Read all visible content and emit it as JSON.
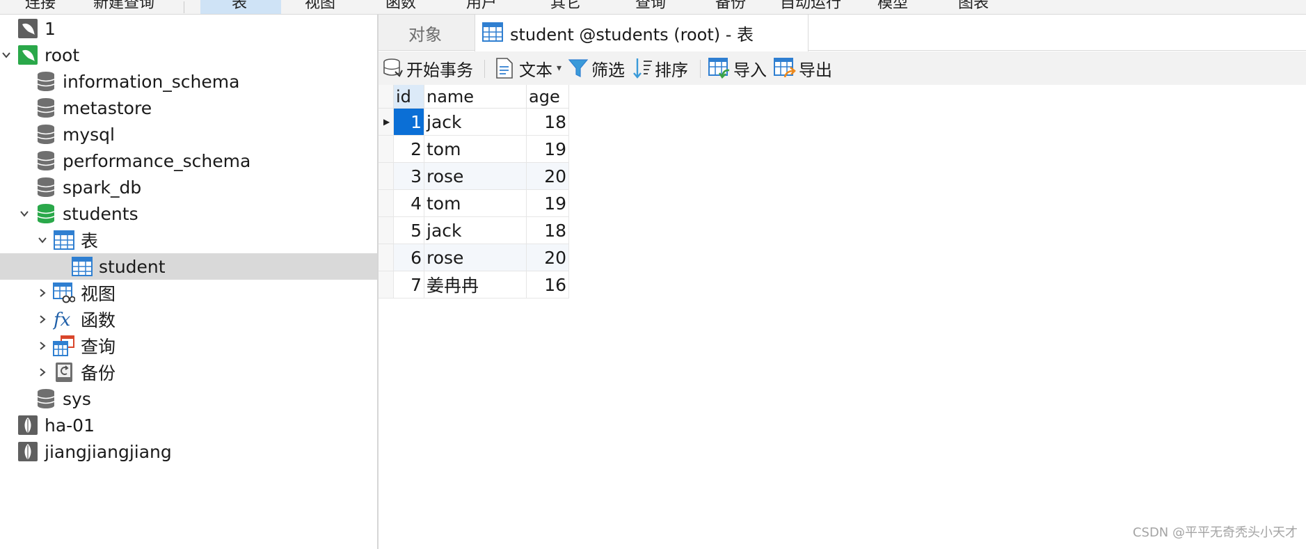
{
  "topbar": {
    "items": [
      "连接",
      "新建查询",
      "表",
      "视图",
      "函数",
      "用户",
      "其它",
      "查询",
      "备份",
      "自动运行",
      "模型",
      "图表"
    ],
    "active": "表"
  },
  "tree": {
    "items": [
      {
        "label": "1",
        "icon": "mysql-connection-icon",
        "chevron": "none"
      },
      {
        "label": "root",
        "icon": "mysql-connection-active-icon",
        "chevron": "down"
      },
      {
        "label": "information_schema",
        "icon": "database-icon",
        "chevron": "none"
      },
      {
        "label": "metastore",
        "icon": "database-icon",
        "chevron": "none"
      },
      {
        "label": "mysql",
        "icon": "database-icon",
        "chevron": "none"
      },
      {
        "label": "performance_schema",
        "icon": "database-icon",
        "chevron": "none"
      },
      {
        "label": "spark_db",
        "icon": "database-icon",
        "chevron": "none"
      },
      {
        "label": "students",
        "icon": "database-open-icon",
        "chevron": "down"
      },
      {
        "label": "表",
        "icon": "table-folder-icon",
        "chevron": "down"
      },
      {
        "label": "student",
        "icon": "table-icon",
        "chevron": "none",
        "selected": true
      },
      {
        "label": "视图",
        "icon": "view-icon",
        "chevron": "right"
      },
      {
        "label": "函数",
        "icon": "function-icon",
        "chevron": "right"
      },
      {
        "label": "查询",
        "icon": "query-icon",
        "chevron": "right"
      },
      {
        "label": "备份",
        "icon": "backup-icon",
        "chevron": "right"
      },
      {
        "label": "sys",
        "icon": "database-icon",
        "chevron": "none"
      },
      {
        "label": "ha-01",
        "icon": "mongodb-connection-icon",
        "chevron": "none"
      },
      {
        "label": "jiangjiangjiang",
        "icon": "mongodb-connection-icon",
        "chevron": "none"
      }
    ]
  },
  "tabs": {
    "objects": "对象",
    "active": "student @students (root) - 表"
  },
  "toolbar": {
    "begin_transaction": "开始事务",
    "text": "文本",
    "filter": "筛选",
    "sort": "排序",
    "import": "导入",
    "export": "导出"
  },
  "grid": {
    "columns": [
      "id",
      "name",
      "age"
    ],
    "rows": [
      {
        "id": "1",
        "name": "jack",
        "age": "18"
      },
      {
        "id": "2",
        "name": "tom",
        "age": "19"
      },
      {
        "id": "3",
        "name": "rose",
        "age": "20"
      },
      {
        "id": "4",
        "name": "tom",
        "age": "19"
      },
      {
        "id": "5",
        "name": "jack",
        "age": "18"
      },
      {
        "id": "6",
        "name": "rose",
        "age": "20"
      },
      {
        "id": "7",
        "name": "姜冉冉",
        "age": "16"
      }
    ]
  },
  "watermark": "CSDN @平平无奇秃头小天才",
  "colors": {
    "selection_blue": "#0b6fd6",
    "tree_selected": "#d9d9d9",
    "db_gray": "#6f6f6f",
    "db_green": "#2aa84a",
    "table_blue": "#2f7fd1"
  }
}
